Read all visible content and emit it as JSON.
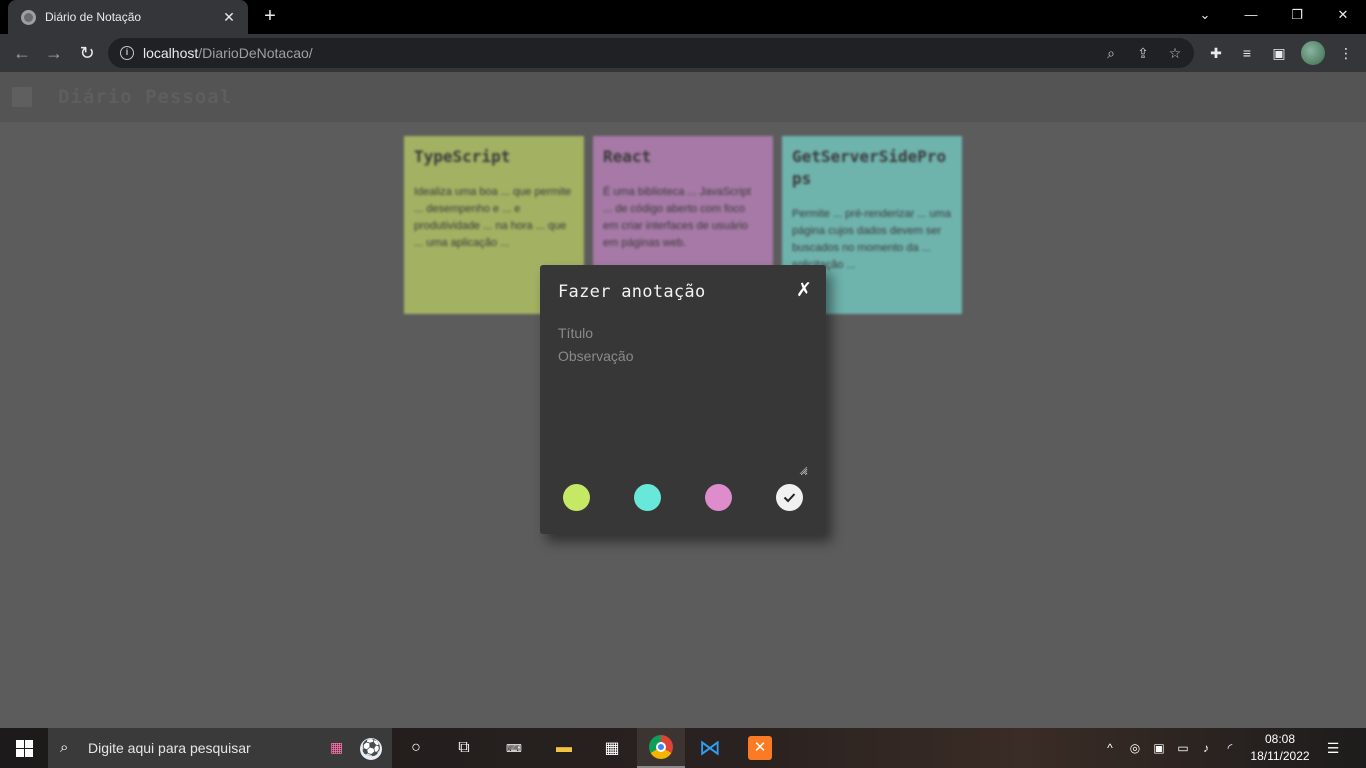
{
  "browser": {
    "tab_title": "Diário de Notação",
    "tab_close": "✕",
    "new_tab": "+",
    "url_host": "localhost",
    "url_path": "/DiarioDeNotacao/"
  },
  "app": {
    "brand": "Diário Pessoal"
  },
  "notes": [
    {
      "title": "TypeScript",
      "body": "Idealiza uma boa ... que permite ... desempenho e ... e produtividade ... na hora ... que ... uma aplicação ...",
      "color": "#a3b163"
    },
    {
      "title": "React",
      "body": "É uma biblioteca ... JavaScript ... de código aberto com foco em criar interfaces de usuário em páginas web.",
      "color": "#a679a6"
    },
    {
      "title": "GetServerSideProps",
      "body": "Permite ... pré-renderizar ... uma página cujos dados devem ser buscados no momento da ... solicitação ...",
      "color": "#6fb3ad"
    }
  ],
  "modal": {
    "title": "Fazer anotação",
    "close": "✗",
    "title_placeholder": "Título",
    "observation_placeholder": "Observação",
    "colors": [
      "#c6e965",
      "#67e8d9",
      "#de8ccb"
    ],
    "confirm_color": "#f1f1f1"
  },
  "taskbar": {
    "search_placeholder": "Digite aqui para pesquisar",
    "time": "08:08",
    "date": "18/11/2022"
  }
}
